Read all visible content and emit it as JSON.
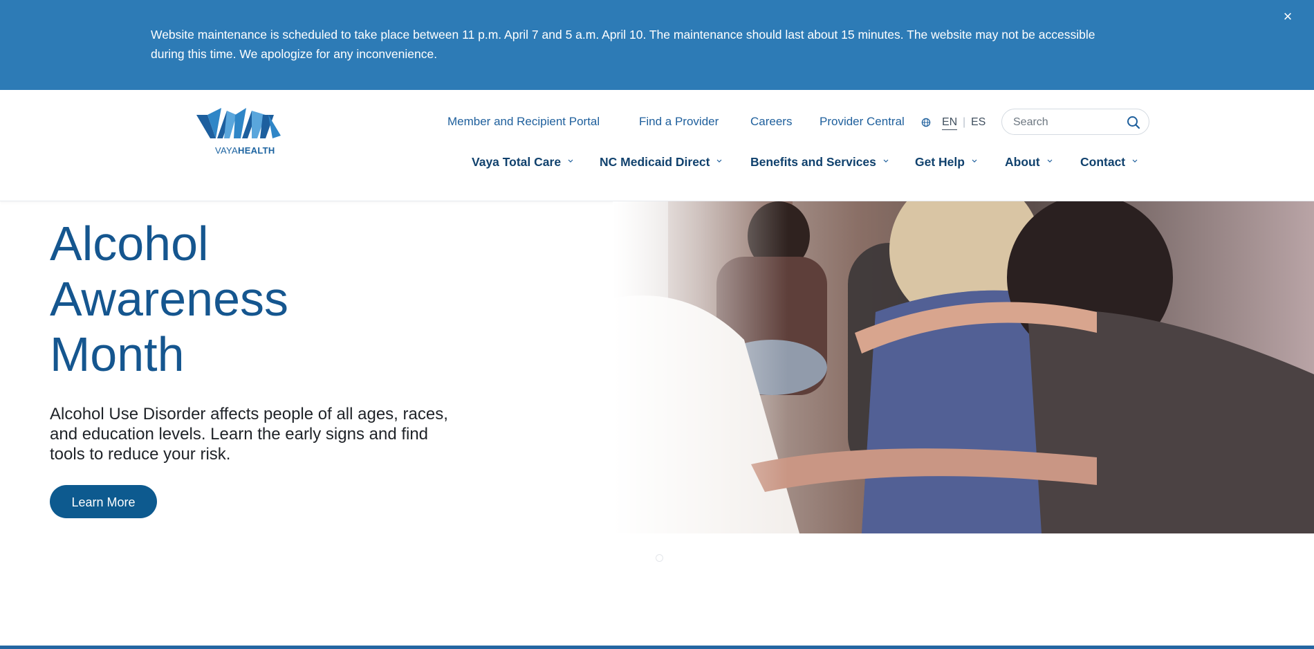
{
  "alert": {
    "message": "Website maintenance is scheduled to take place between 11 p.m. April 7 and 5 a.m. April 10. The maintenance should last about 15 minutes. The website may not be accessible during this time. We apologize for any inconvenience.",
    "close_label": "×"
  },
  "logo": {
    "text_light": "VAYA",
    "text_bold": "HEALTH",
    "icon": "vaya-logo-mark"
  },
  "utility_nav": [
    {
      "label": "Member and Recipient Portal"
    },
    {
      "label": "Find a Provider"
    },
    {
      "label": "Careers"
    },
    {
      "label": "Provider Central"
    }
  ],
  "language": {
    "icon": "globe-icon",
    "options": [
      "EN",
      "ES"
    ],
    "separator": "|",
    "active": "EN"
  },
  "search": {
    "placeholder": "Search",
    "icon": "search-icon"
  },
  "main_nav": [
    {
      "label": "Vaya Total Care"
    },
    {
      "label": "NC Medicaid Direct"
    },
    {
      "label": "Benefits and Services"
    },
    {
      "label": "Get Help"
    },
    {
      "label": "About"
    },
    {
      "label": "Contact"
    }
  ],
  "hero": {
    "title_line1": "Alcohol",
    "title_line2": "Awareness",
    "title_line3": "Month",
    "description": "Alcohol Use Disorder affects people of all ages, races, and education levels. Learn the early signs and find tools to reduce your risk.",
    "button_label": "Learn More"
  },
  "colors": {
    "alert_bg": "#2d7bb6",
    "brand_blue": "#15568f",
    "nav_text": "#10416d",
    "button_bg": "#0d5a8f"
  }
}
